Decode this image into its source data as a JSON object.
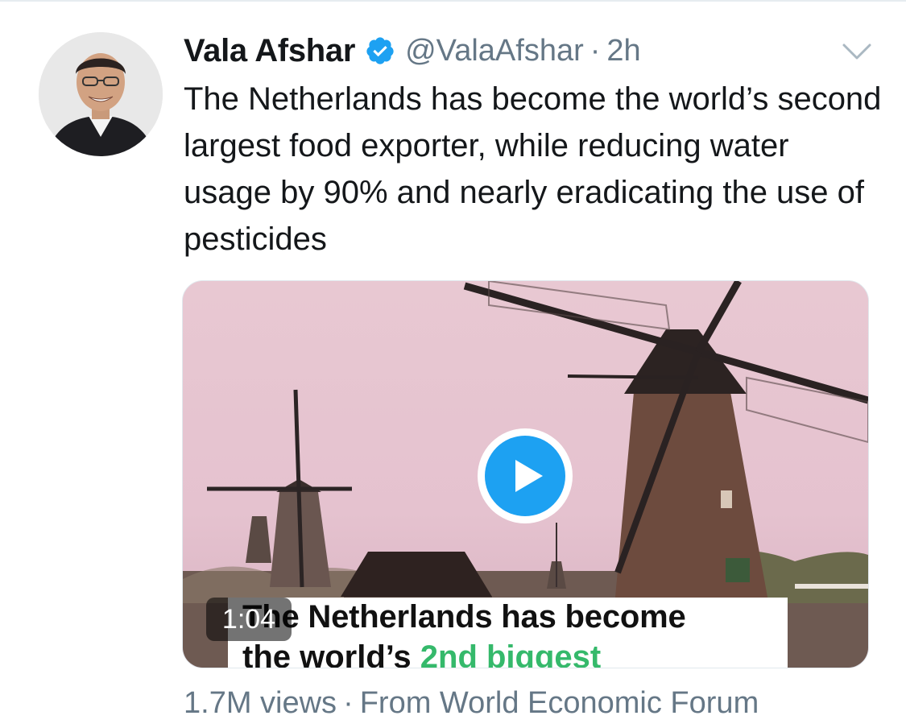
{
  "tweet": {
    "display_name": "Vala Afshar",
    "handle": "@ValaAfshar",
    "separator": "·",
    "time": "2h",
    "text": "The Netherlands has become the world’s second largest food exporter, while reducing water usage by 90% and nearly eradicating the use of pesticides"
  },
  "media": {
    "duration": "1:04",
    "caption_line1": "The Netherlands has become",
    "caption_line2_prefix": "the world’s ",
    "caption_line2_accent": "2nd biggest",
    "accent_color": "#35b96b"
  },
  "footer": {
    "views": "1.7M views",
    "separator": "·",
    "source": "From World Economic Forum"
  },
  "colors": {
    "verified": "#1da1f2",
    "secondary_text": "#657786",
    "play_button": "#1da1f2"
  },
  "icons": {
    "verified": "verified-badge-icon",
    "chevron": "chevron-down-icon",
    "play": "play-icon"
  }
}
